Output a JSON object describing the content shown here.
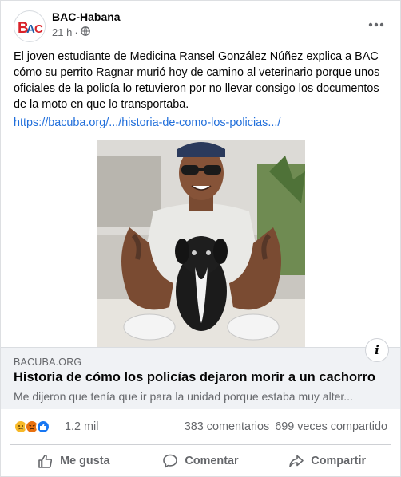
{
  "post": {
    "page_name": "BAC-Habana",
    "time": "21 h",
    "separator": "·",
    "privacy_icon": "globe-icon",
    "text": "El joven estudiante de Medicina Ransel González Núñez explica a BAC cómo su perrito Ragnar murió hoy de camino al veterinario porque unos oficiales de la policía lo retuvieron por no llevar consigo los documentos de la moto en que lo transportaba.",
    "link": "https://bacuba.org/.../historia-de-como-los-policias.../"
  },
  "preview": {
    "domain": "BACUBA.ORG",
    "headline": "Historia de cómo los policías dejaron morir a un cachorro",
    "description": "Me dijeron que tenía que ir para la unidad porque estaba muy alter...",
    "info_label": "i"
  },
  "stats": {
    "reactions": [
      "sad",
      "angry",
      "like"
    ],
    "reaction_count": "1.2 mil",
    "comments": "383 comentarios",
    "shares": "699 veces compartido"
  },
  "actions": {
    "like": "Me gusta",
    "comment": "Comentar",
    "share": "Compartir"
  },
  "colors": {
    "link": "#216fdb",
    "secondary_text": "#65676b",
    "preview_bg": "#f0f2f5",
    "like_blue": "#1877f2",
    "avatar_red": "#d9232a",
    "avatar_blue": "#1f5fa8"
  }
}
